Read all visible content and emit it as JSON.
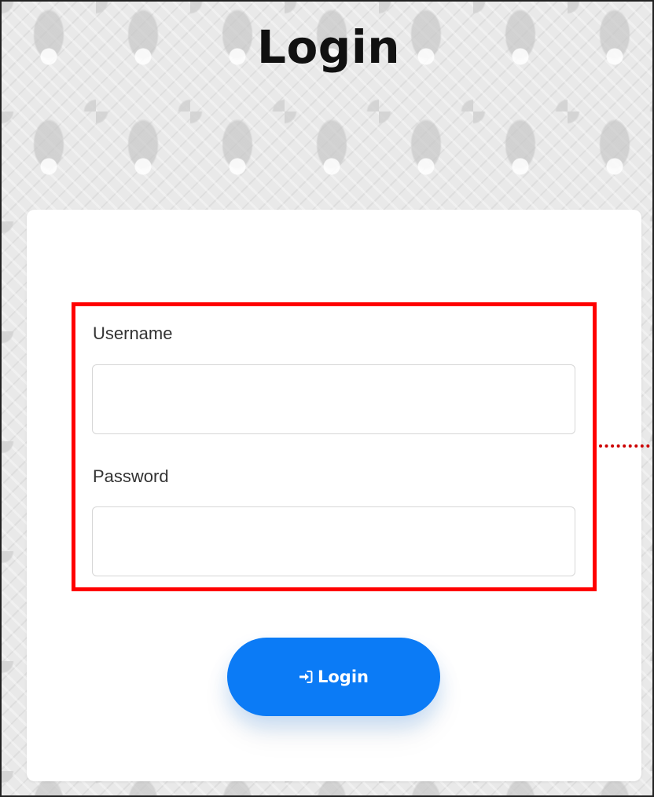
{
  "page": {
    "title": "Login"
  },
  "form": {
    "username": {
      "label": "Username",
      "value": "",
      "placeholder": ""
    },
    "password": {
      "label": "Password",
      "value": "",
      "placeholder": ""
    },
    "submit": {
      "label": "Login",
      "icon": "sign-in-icon"
    }
  },
  "annotation": {
    "highlight_color": "#ff0000"
  },
  "colors": {
    "accent": "#0b7bf6",
    "card": "#ffffff",
    "title": "#111111"
  }
}
